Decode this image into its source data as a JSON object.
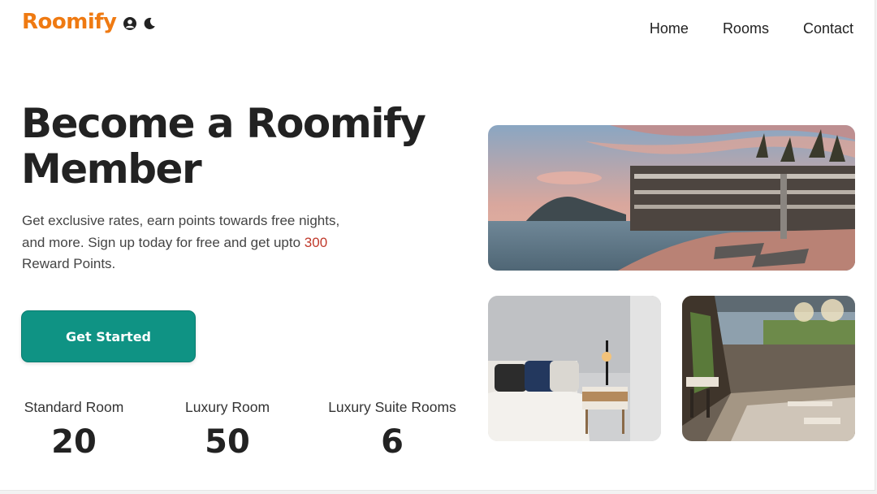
{
  "brand": {
    "name": "Roomify",
    "color": "#ef7a12"
  },
  "header": {
    "icons": [
      "user-circle-icon",
      "moon-icon"
    ],
    "nav": [
      {
        "label": "Home"
      },
      {
        "label": "Rooms"
      },
      {
        "label": "Contact"
      }
    ]
  },
  "hero": {
    "title_line1": "Become a Roomify",
    "title_line2": "Member",
    "desc_before": "Get exclusive rates, earn points towards free nights, and more. Sign up today for free and get upto ",
    "desc_points": "300",
    "desc_after": " Reward Points.",
    "cta_label": "Get Started",
    "cta_color": "#0f9384",
    "highlight_color": "#c0392b"
  },
  "stats": [
    {
      "label": "Standard Room",
      "value": "20"
    },
    {
      "label": "Luxury Room",
      "value": "50"
    },
    {
      "label": "Luxury Suite Rooms",
      "value": "6"
    }
  ],
  "gallery": {
    "images": [
      "resort-photo",
      "bedroom-photo",
      "restaurant-photo"
    ]
  }
}
